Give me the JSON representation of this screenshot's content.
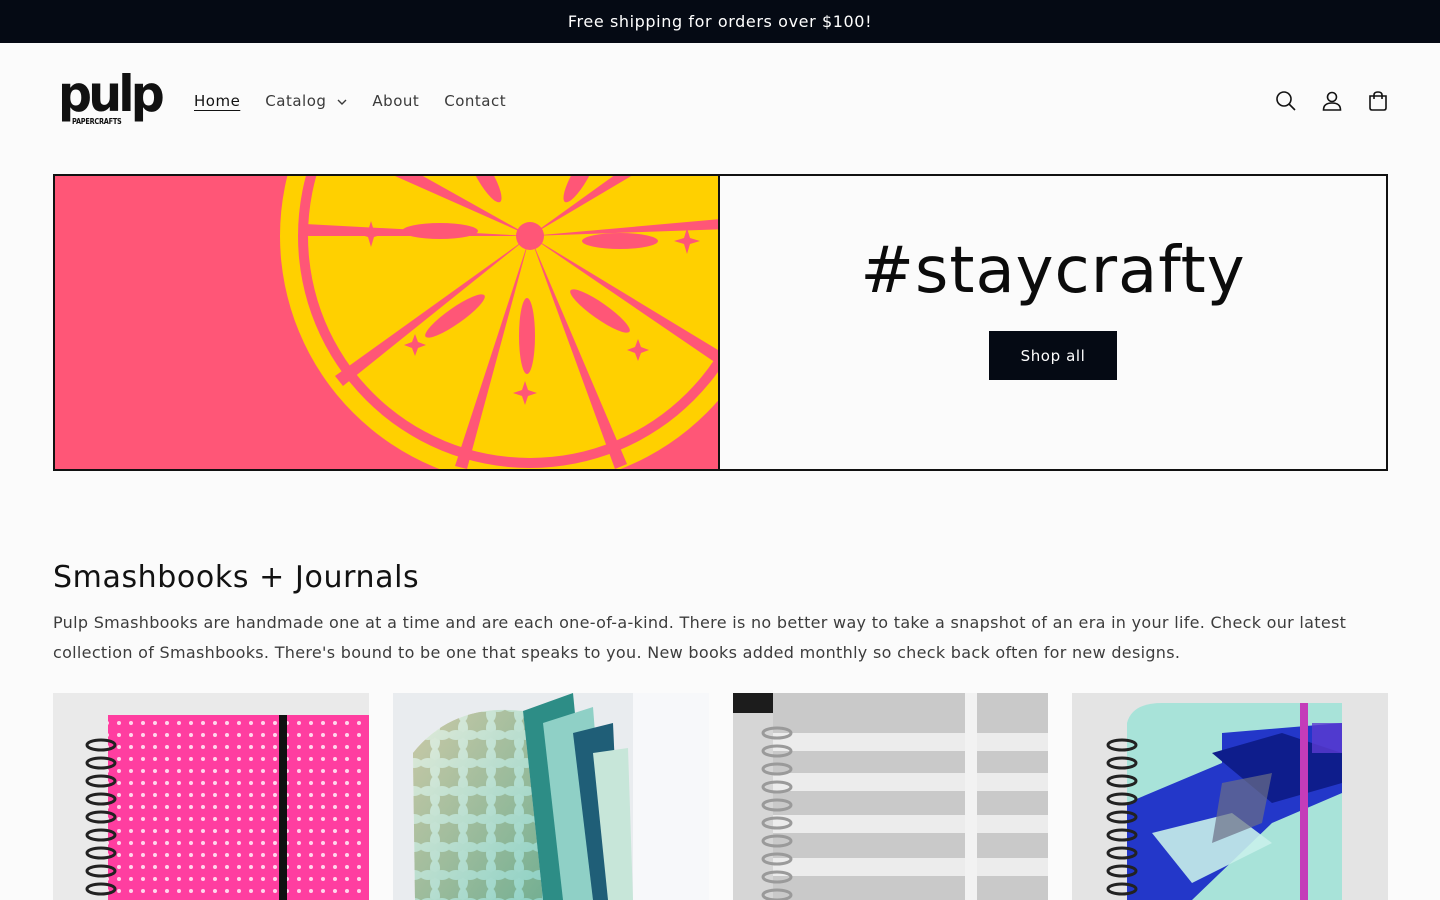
{
  "announcement": {
    "text": "Free shipping for orders over $100!"
  },
  "logo": {
    "word": "pulp",
    "sub": "PAPERCRAFTS"
  },
  "nav": {
    "home": "Home",
    "catalog": "Catalog",
    "about": "About",
    "contact": "Contact"
  },
  "icons": [
    "search-icon",
    "account-icon",
    "cart-icon"
  ],
  "hero": {
    "title": "#staycrafty",
    "button": "Shop all"
  },
  "collection": {
    "title": "Smashbooks + Journals",
    "description": "Pulp Smashbooks are handmade one at a time and are each one-of-a-kind. There is no better way to take a snapshot of an era in your life. Check our latest collection of Smashbooks. There's bound to be one that speaks to you. New books added monthly so check back often for new designs."
  },
  "colors": {
    "accent_dark": "#050a14",
    "hero_pink": "#ff5677",
    "hero_yellow": "#ffd000"
  }
}
